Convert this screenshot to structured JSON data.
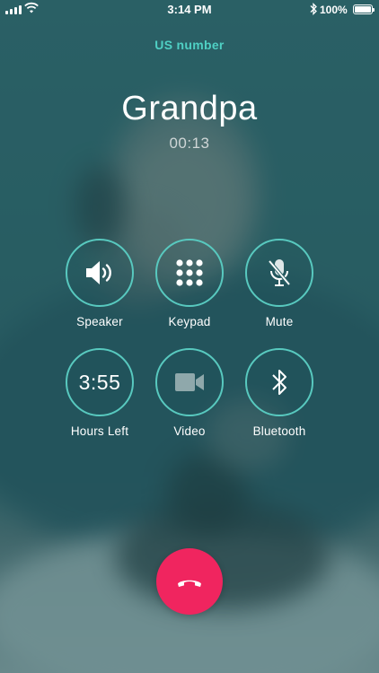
{
  "status_bar": {
    "time": "3:14 PM",
    "battery_percent": "100%",
    "battery_level": 1.0,
    "signal_bars": 4,
    "icons": [
      "signal-icon",
      "wifi-icon",
      "bluetooth-icon",
      "battery-icon"
    ]
  },
  "call": {
    "carrier": "US number",
    "contact_name": "Grandpa",
    "duration": "00:13"
  },
  "controls": {
    "speaker": {
      "label": "Speaker",
      "icon": "speaker-icon"
    },
    "keypad": {
      "label": "Keypad",
      "icon": "keypad-icon"
    },
    "mute": {
      "label": "Mute",
      "icon": "mic-muted-icon"
    },
    "hours_left": {
      "label": "Hours Left",
      "value": "3:55"
    },
    "video": {
      "label": "Video",
      "icon": "video-camera-icon"
    },
    "bluetooth": {
      "label": "Bluetooth",
      "icon": "bluetooth-icon"
    }
  },
  "end_call": {
    "icon": "hang-up-icon"
  },
  "colors": {
    "accent": "#58c9bf",
    "carrier_text": "#4fd0c4",
    "end_call": "#f0255f"
  }
}
